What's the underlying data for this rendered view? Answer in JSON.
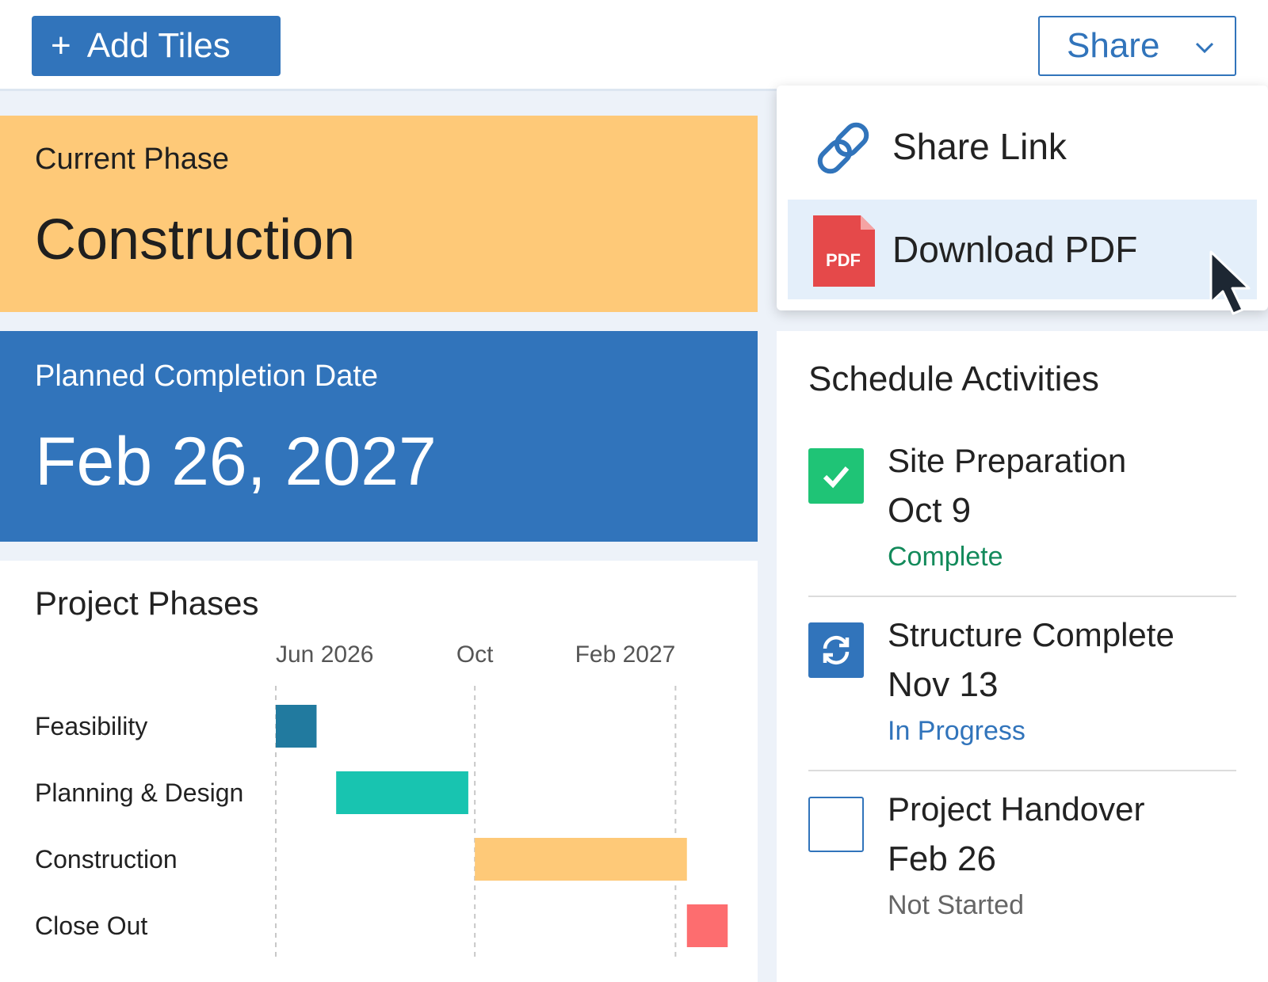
{
  "toolbar": {
    "add_tiles_label": "Add Tiles",
    "share_label": "Share"
  },
  "share_menu": {
    "items": [
      {
        "label": "Share Link",
        "icon": "link-icon"
      },
      {
        "label": "Download PDF",
        "icon": "pdf-file-icon",
        "icon_text": "PDF"
      }
    ]
  },
  "current_phase": {
    "label": "Current Phase",
    "value": "Construction"
  },
  "completion": {
    "label": "Planned Completion Date",
    "value": "Feb 26, 2027"
  },
  "project_phases": {
    "title": "Project Phases"
  },
  "chart_data": {
    "type": "gantt",
    "title": "Project Phases",
    "x_tick_labels": [
      "Jun 2026",
      "Oct",
      "Feb 2027"
    ],
    "x_ticks": [
      "2026-06-01",
      "2026-10-01",
      "2027-02-01"
    ],
    "xlim": [
      "2026-06-01",
      "2027-03-01"
    ],
    "grid": "vertical dashed",
    "categories": [
      "Feasibility",
      "Planning & Design",
      "Construction",
      "Close Out"
    ],
    "bars": [
      {
        "name": "Feasibility",
        "start": "2026-06-01",
        "end": "2026-06-26",
        "color": "#217a9f"
      },
      {
        "name": "Planning & Design",
        "start": "2026-07-08",
        "end": "2026-09-27",
        "color": "#18c4b0"
      },
      {
        "name": "Construction",
        "start": "2026-10-01",
        "end": "2027-02-08",
        "color": "#fec978"
      },
      {
        "name": "Close Out",
        "start": "2027-02-08",
        "end": "2027-03-05",
        "color": "#fd6d6f"
      }
    ]
  },
  "schedule": {
    "title": "Schedule Activities",
    "activities": [
      {
        "name": "Site Preparation",
        "date": "Oct 9",
        "status": "Complete",
        "status_color": "#138a5b",
        "icon": "check-icon"
      },
      {
        "name": "Structure Complete",
        "date": "Nov 13",
        "status": "In Progress",
        "status_color": "#3174bb",
        "icon": "refresh-icon"
      },
      {
        "name": "Project Handover",
        "date": "Feb 26",
        "status": "Not Started",
        "status_color": "#666666",
        "icon": "empty-checkbox-icon"
      }
    ]
  },
  "colors": {
    "accent": "#3174bb",
    "phase_tile": "#fec978",
    "complete": "#1fc476"
  }
}
